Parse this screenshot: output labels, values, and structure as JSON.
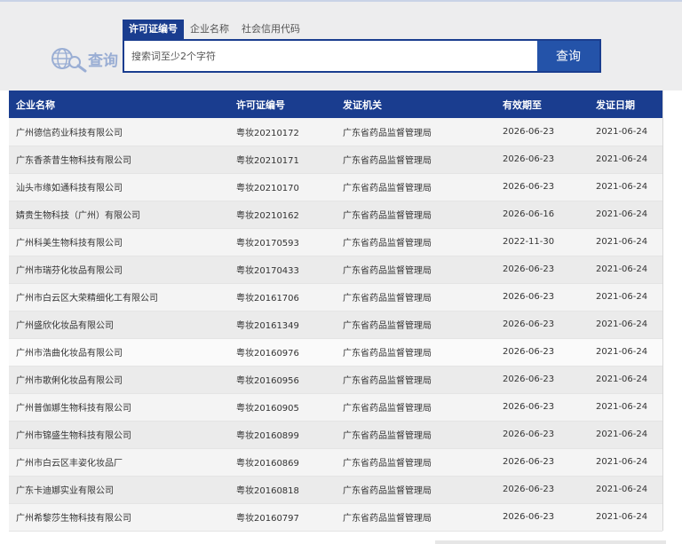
{
  "search": {
    "logo_text": "查询",
    "tabs": [
      {
        "label": "许可证编号",
        "active": true
      },
      {
        "label": "企业名称",
        "active": false
      },
      {
        "label": "社会信用代码",
        "active": false
      }
    ],
    "placeholder": "搜索词至少2个字符",
    "button_label": "查询"
  },
  "table": {
    "headers": [
      "企业名称",
      "许可证编号",
      "发证机关",
      "有效期至",
      "发证日期"
    ],
    "rows": [
      [
        "广州德信药业科技有限公司",
        "粤妆20210172",
        "广东省药品监督管理局",
        "2026-06-23",
        "2021-06-24"
      ],
      [
        "广东香荼昔生物科技有限公司",
        "粤妆20210171",
        "广东省药品监督管理局",
        "2026-06-23",
        "2021-06-24"
      ],
      [
        "汕头市缘如通科技有限公司",
        "粤妆20210170",
        "广东省药品监督管理局",
        "2026-06-23",
        "2021-06-24"
      ],
      [
        "婧贵生物科技（广州）有限公司",
        "粤妆20210162",
        "广东省药品监督管理局",
        "2026-06-16",
        "2021-06-24"
      ],
      [
        "广州科美生物科技有限公司",
        "粤妆20170593",
        "广东省药品监督管理局",
        "2022-11-30",
        "2021-06-24"
      ],
      [
        "广州市瑞芬化妆品有限公司",
        "粤妆20170433",
        "广东省药品监督管理局",
        "2026-06-23",
        "2021-06-24"
      ],
      [
        "广州市白云区大荣精细化工有限公司",
        "粤妆20161706",
        "广东省药品监督管理局",
        "2026-06-23",
        "2021-06-24"
      ],
      [
        "广州盛欣化妆品有限公司",
        "粤妆20161349",
        "广东省药品监督管理局",
        "2026-06-23",
        "2021-06-24"
      ],
      [
        "广州市浩曲化妆品有限公司",
        "粤妆20160976",
        "广东省药品监督管理局",
        "2026-06-23",
        "2021-06-24"
      ],
      [
        "广州市歌俐化妆品有限公司",
        "粤妆20160956",
        "广东省药品监督管理局",
        "2026-06-23",
        "2021-06-24"
      ],
      [
        "广州普伽娜生物科技有限公司",
        "粤妆20160905",
        "广东省药品监督管理局",
        "2026-06-23",
        "2021-06-24"
      ],
      [
        "广州市锦盛生物科技有限公司",
        "粤妆20160899",
        "广东省药品监督管理局",
        "2026-06-23",
        "2021-06-24"
      ],
      [
        "广州市白云区丰姿化妆品厂",
        "粤妆20160869",
        "广东省药品监督管理局",
        "2026-06-23",
        "2021-06-24"
      ],
      [
        "广东卡迪娜实业有限公司",
        "粤妆20160818",
        "广东省药品监督管理局",
        "2026-06-23",
        "2021-06-24"
      ],
      [
        "广州希黎莎生物科技有限公司",
        "粤妆20160797",
        "广东省药品监督管理局",
        "2026-06-23",
        "2021-06-24"
      ]
    ]
  },
  "colors": {
    "header_bg": "#1a3d8f",
    "button_bg": "#2453a9",
    "panel_bg": "#ededee"
  }
}
